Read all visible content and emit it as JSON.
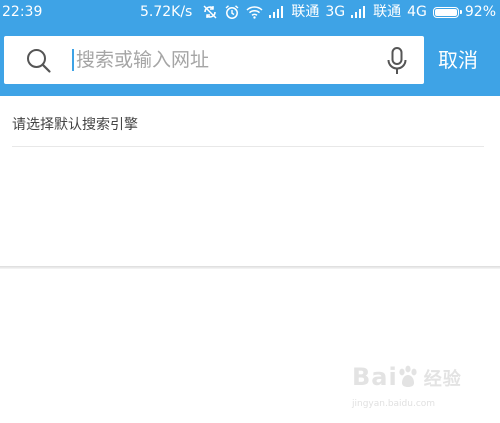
{
  "status_bar": {
    "time": "22:39",
    "network_speed": "5.72K/s",
    "carrier_1": "联通",
    "network_1": "3G",
    "carrier_2": "联通",
    "network_2": "4G",
    "battery_percent": "92%",
    "battery_level": 0.92,
    "icons": [
      "sync-off-icon",
      "alarm-icon",
      "wifi-icon",
      "signal-icon",
      "signal-icon",
      "battery-icon"
    ]
  },
  "search": {
    "placeholder": "搜索或输入网址",
    "value": ""
  },
  "cancel_label": "取消",
  "engine_hint": "请选择默认搜索引擎",
  "watermark": {
    "logo_text": "Bai",
    "logo_suffix": "经验",
    "url": "jingyan.baidu.com"
  },
  "colors": {
    "accent": "#3ea3e6",
    "text": "#444444",
    "placeholder": "#a5a5a5"
  }
}
